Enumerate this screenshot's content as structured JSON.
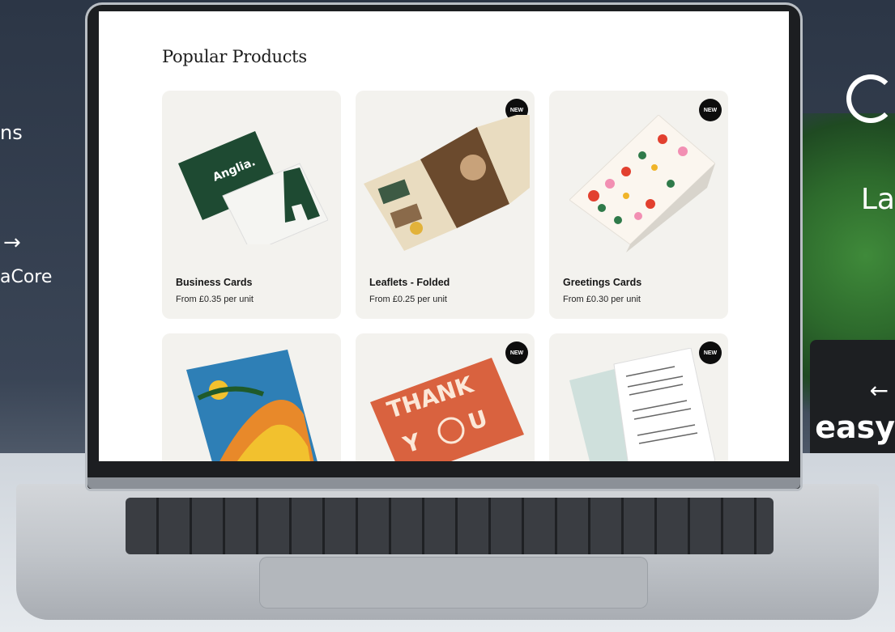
{
  "background": {
    "left_logos": [
      "ns",
      "aCore"
    ],
    "right_logos": [
      "La",
      "easy"
    ]
  },
  "page": {
    "section_title": "Popular Products"
  },
  "products": [
    {
      "name": "Business Cards",
      "price": "From £0.35 per unit",
      "badge": "",
      "icon": "business-card-image"
    },
    {
      "name": "Leaflets - Folded",
      "price": "From £0.25 per unit",
      "badge": "NEW",
      "icon": "leaflet-image"
    },
    {
      "name": "Greetings Cards",
      "price": "From £0.30 per unit",
      "badge": "NEW",
      "icon": "greeting-card-image"
    },
    {
      "name": "",
      "price": "",
      "badge": "",
      "icon": "art-print-image"
    },
    {
      "name": "",
      "price": "",
      "badge": "NEW",
      "icon": "thank-you-card-image"
    },
    {
      "name": "",
      "price": "",
      "badge": "NEW",
      "icon": "menu-card-image"
    }
  ],
  "business_card": {
    "brand": "Anglia."
  },
  "thank_you": {
    "text1": "THANK",
    "text2": "Y",
    "text3": "U"
  },
  "colors": {
    "badge": "#0d0d0d",
    "card_bg": "#f3f2ee",
    "business_green": "#1e4a32",
    "thank_you_orange": "#d9623f"
  }
}
